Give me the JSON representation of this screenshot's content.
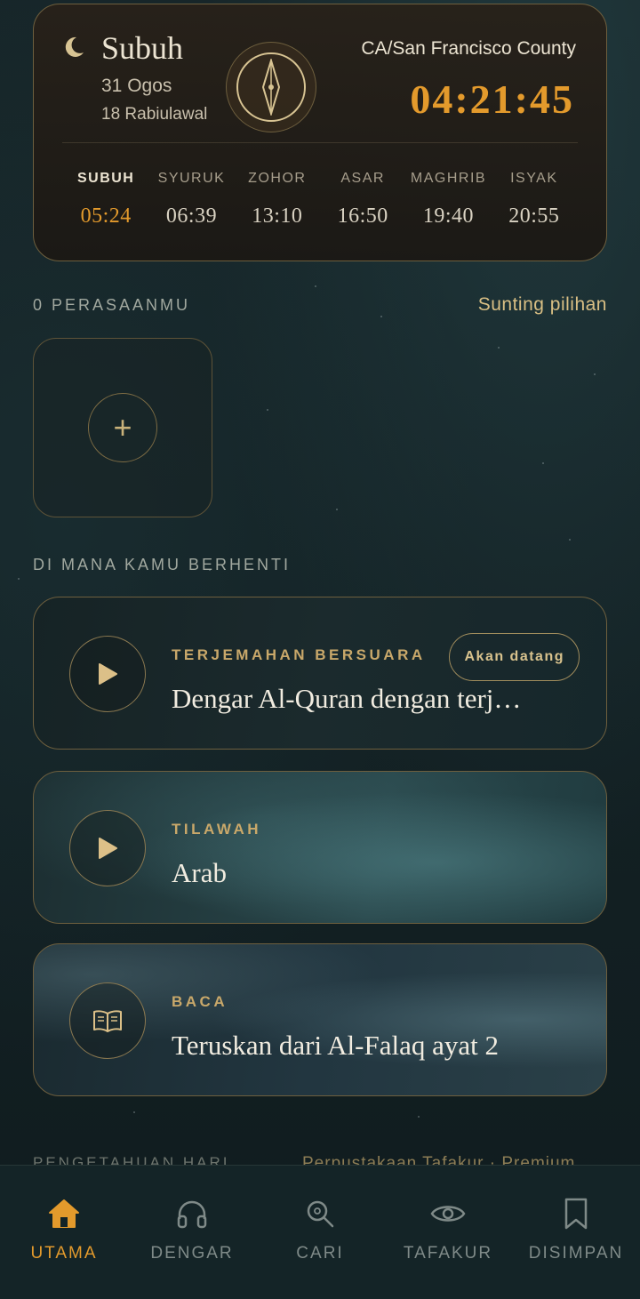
{
  "prayer_card": {
    "current_prayer": "Subuh",
    "gregorian_date": "31 Ogos",
    "hijri_date": "18 Rabiulawal",
    "location": "CA/San Francisco County",
    "countdown": "04:21:45",
    "times": [
      {
        "name": "SUBUH",
        "time": "05:24",
        "active": true
      },
      {
        "name": "SYURUK",
        "time": "06:39",
        "active": false
      },
      {
        "name": "ZOHOR",
        "time": "13:10",
        "active": false
      },
      {
        "name": "ASAR",
        "time": "16:50",
        "active": false
      },
      {
        "name": "MAGHRIB",
        "time": "19:40",
        "active": false
      },
      {
        "name": "ISYAK",
        "time": "20:55",
        "active": false
      }
    ]
  },
  "moods": {
    "label": "0 PERASAANMU",
    "edit_label": "Sunting pilihan",
    "add_icon": "+"
  },
  "resume": {
    "label": "DI MANA KAMU BERHENTI",
    "cards": [
      {
        "kicker": "TERJEMAHAN BERSUARA",
        "title": "Dengar Al-Quran dengan terj…",
        "badge": "Akan datang",
        "icon": "play-icon"
      },
      {
        "kicker": "TILAWAH",
        "title": "Arab",
        "icon": "play-icon"
      },
      {
        "kicker": "BACA",
        "title": "Teruskan dari Al-Falaq ayat 2",
        "icon": "book-icon"
      }
    ]
  },
  "peek": {
    "left": "PENGETAHUAN HARI",
    "right": "Perpustakaan Tafakur · Premium"
  },
  "nav": {
    "items": [
      {
        "label": "UTAMA",
        "icon": "home-icon",
        "active": true
      },
      {
        "label": "DENGAR",
        "icon": "headphones-icon",
        "active": false
      },
      {
        "label": "CARI",
        "icon": "search-icon",
        "active": false
      },
      {
        "label": "TAFAKUR",
        "icon": "eye-icon",
        "active": false
      },
      {
        "label": "DISIMPAN",
        "icon": "bookmark-icon",
        "active": false
      }
    ]
  },
  "colors": {
    "accent": "#e39a2c",
    "gold": "#c9a86a",
    "border": "#6e5f3e"
  }
}
